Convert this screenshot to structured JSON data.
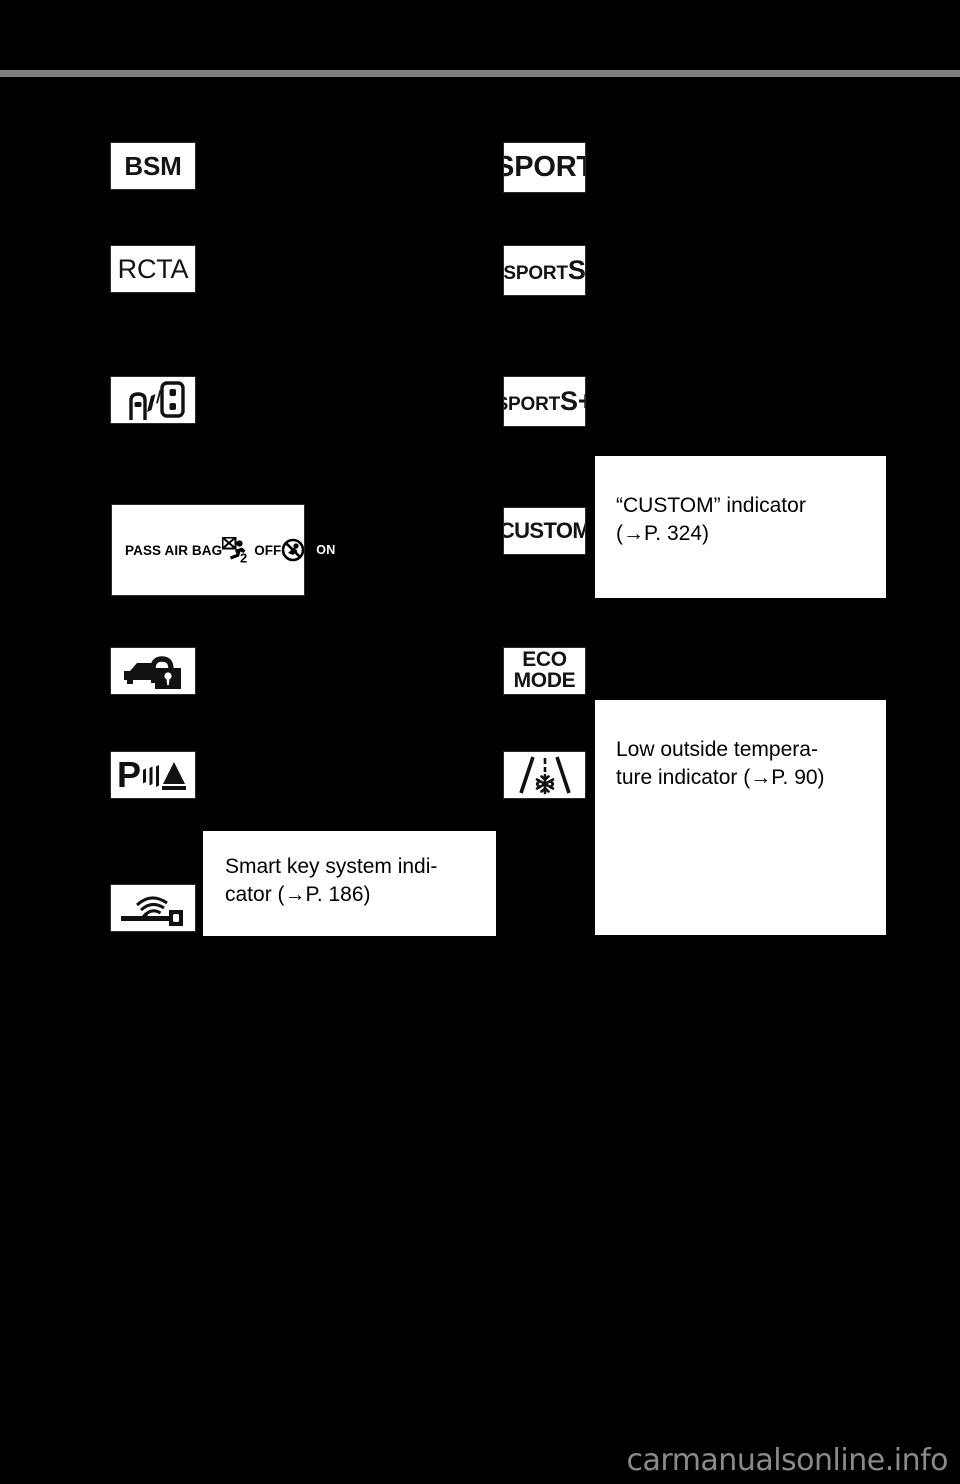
{
  "page": {
    "background_color": "#000000",
    "rule_color": "#808080",
    "watermark": "carmanualsonline.info",
    "watermark_color": "#8a8a8a"
  },
  "left_column": {
    "badges": [
      {
        "name": "bsm-indicator",
        "label": "BSM",
        "kind": "text"
      },
      {
        "name": "rcta-indicator",
        "label": "RCTA",
        "kind": "text"
      },
      {
        "name": "blind-spot-monitor-indicator",
        "label": "",
        "kind": "icon",
        "icon": "two-cars-alert-icon"
      },
      {
        "name": "theft-deterrent-indicator",
        "label": "",
        "kind": "icon",
        "icon": "car-padlock-icon"
      },
      {
        "name": "parking-assist-indicator",
        "label": "",
        "kind": "icon",
        "icon": "parking-sonar-icon"
      },
      {
        "name": "smart-key-system-indicator",
        "label": "",
        "kind": "icon",
        "icon": "key-signal-icon"
      }
    ],
    "airbag_panel": {
      "name": "passenger-airbag-status-panel",
      "label": "PASS AIR BAG",
      "off_text": "OFF",
      "on_text": "ON",
      "off_icon": "airbag-off-occupant-icon",
      "on_icon": "airbag-on-crossed-circle-icon"
    },
    "callout": {
      "name": "smart-key-callout",
      "text": "Smart key system indi-cator (→P. 186)",
      "line1": "Smart key system indi-",
      "line2": "cator (→P. 186)",
      "page_ref": "186"
    }
  },
  "right_column": {
    "badges": [
      {
        "name": "sport-mode-indicator",
        "label": "SPORT",
        "kind": "text"
      },
      {
        "name": "sport-s-mode-indicator",
        "label": "SPORT S",
        "kind": "text",
        "prefix": "SPORT",
        "suffix": "S"
      },
      {
        "name": "sport-s-plus-mode-indicator",
        "label": "SPORT S+",
        "kind": "text",
        "prefix": "SPORT",
        "suffix": "S+"
      },
      {
        "name": "custom-mode-indicator",
        "label": "CUSTOM",
        "kind": "text"
      },
      {
        "name": "eco-mode-indicator",
        "label": "ECO MODE",
        "kind": "text",
        "line1": "ECO",
        "line2": "MODE"
      },
      {
        "name": "low-outside-temperature-indicator",
        "label": "",
        "kind": "icon",
        "icon": "road-snowflake-icon"
      }
    ],
    "callouts": [
      {
        "name": "custom-indicator-callout",
        "line1": "“CUSTOM” indicator",
        "line2": "(→P. 324)",
        "page_ref": "324"
      },
      {
        "name": "low-temperature-callout",
        "line1": "Low outside tempera-",
        "line2": "ture indicator (→P. 90)",
        "page_ref": "90"
      }
    ]
  }
}
